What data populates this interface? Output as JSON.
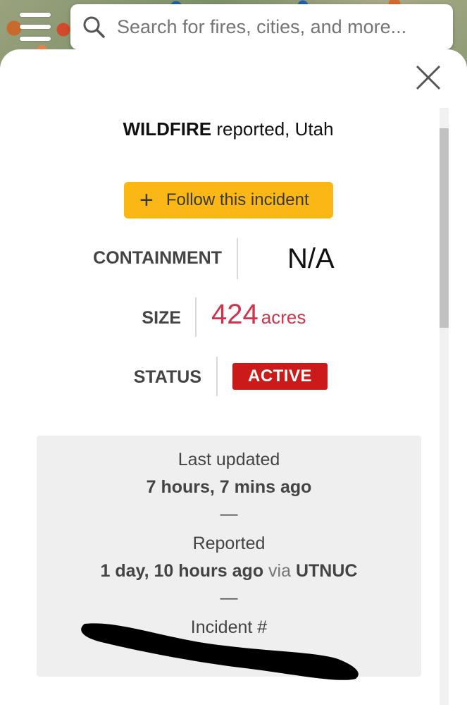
{
  "search": {
    "placeholder": "Search for fires, cities, and more..."
  },
  "incident": {
    "type": "WILDFIRE",
    "reported_text": " reported, Utah",
    "follow_label": "Follow this incident",
    "containment_label": "CONTAINMENT",
    "containment_value": "N/A",
    "size_label": "SIZE",
    "size_value": "424",
    "size_unit": "acres",
    "status_label": "STATUS",
    "status_value": "ACTIVE"
  },
  "details": {
    "last_updated_label": "Last updated",
    "last_updated_value": "7 hours, 7 mins ago",
    "separator_1": "—",
    "reported_label": "Reported",
    "reported_value": "1 day, 10 hours ago",
    "via_text": " via ",
    "source": "UTNUC",
    "separator_2": "—",
    "incident_number_label": "Incident #"
  },
  "colors": {
    "follow_button": "#fbb716",
    "status_active": "#cc1a1a",
    "size_value": "#d0334a"
  },
  "icons": [
    "menu-icon",
    "search-icon",
    "close-icon",
    "plus-icon"
  ]
}
